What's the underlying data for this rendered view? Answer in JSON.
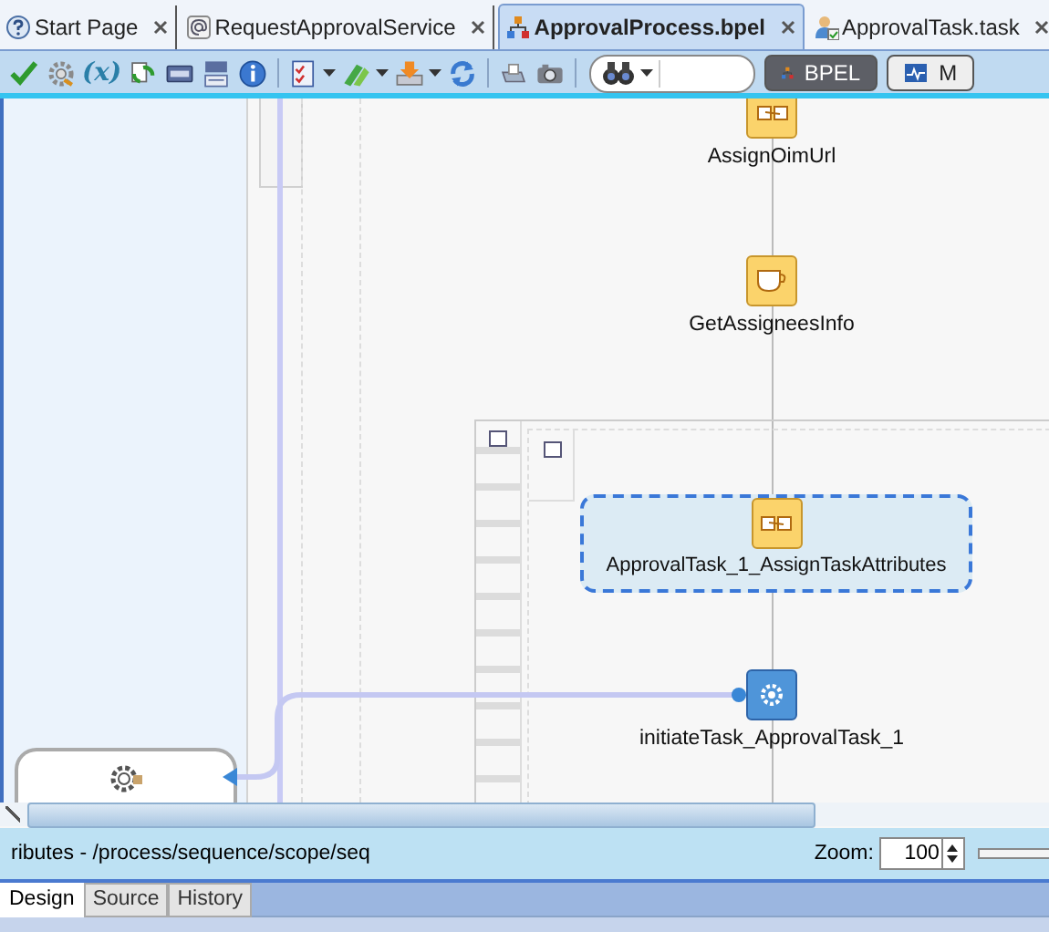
{
  "tabs": [
    {
      "label": "Start Page",
      "selected": false
    },
    {
      "label": "RequestApprovalService",
      "selected": false
    },
    {
      "label": "ApprovalProcess.bpel",
      "selected": true
    },
    {
      "label": "ApprovalTask.task",
      "selected": false
    }
  ],
  "toolbar": [
    {
      "kind": "check"
    },
    {
      "kind": "gear"
    },
    {
      "kind": "text",
      "text": "(x)"
    },
    {
      "kind": "swap"
    },
    {
      "kind": "card"
    },
    {
      "kind": "list"
    },
    {
      "kind": "info"
    },
    {
      "kind": "sep"
    },
    {
      "kind": "checklist",
      "dropdown": true
    },
    {
      "kind": "arrows",
      "dropdown": true
    },
    {
      "kind": "deploy",
      "dropdown": true
    },
    {
      "kind": "refresh"
    },
    {
      "kind": "sep"
    },
    {
      "kind": "printer"
    },
    {
      "kind": "camera"
    },
    {
      "kind": "sep"
    },
    {
      "kind": "search"
    }
  ],
  "views": [
    {
      "label": "BPEL",
      "selected": true
    },
    {
      "label": "M",
      "selected": false
    }
  ],
  "nodes": [
    {
      "label": "AssignOimUrl",
      "kind": "assign",
      "selected": false
    },
    {
      "label": "GetAssigneesInfo",
      "kind": "script",
      "selected": false
    },
    {
      "label": "ApprovalTask_1_AssignTaskAttributes",
      "kind": "assign",
      "selected": true
    },
    {
      "label": "initiateTask_ApprovalTask_1",
      "kind": "invoke",
      "selected": false
    }
  ],
  "status": {
    "path": "ributes - /process/sequence/scope/seq",
    "zoom_label": "Zoom:",
    "zoom": "100"
  },
  "bottom_tabs": [
    {
      "label": "Design",
      "selected": true
    },
    {
      "label": "Source",
      "selected": false
    },
    {
      "label": "History",
      "selected": false
    }
  ]
}
